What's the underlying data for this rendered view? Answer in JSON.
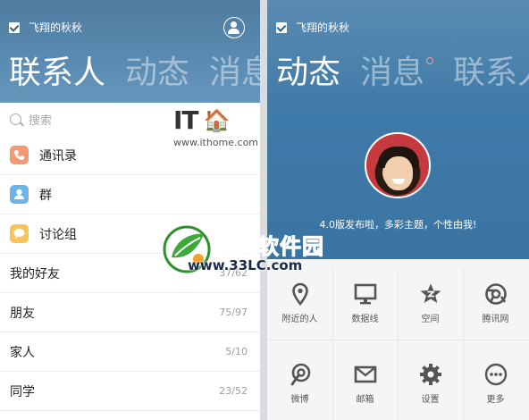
{
  "left": {
    "account_name": "飞翔的秋秋",
    "tabs": [
      {
        "label": "联系人"
      },
      {
        "label": "动态"
      },
      {
        "label": "消息"
      }
    ],
    "search_placeholder": "搜索",
    "entries": [
      {
        "label": "通讯录",
        "icon": "phone-icon",
        "color": "#f39a74"
      },
      {
        "label": "群",
        "icon": "group-icon",
        "color": "#6cb3e8"
      },
      {
        "label": "讨论组",
        "icon": "chat-icon",
        "color": "#f6c458"
      }
    ],
    "groups": [
      {
        "name": "我的好友",
        "count": "37/62"
      },
      {
        "name": "朋友",
        "count": "75/97"
      },
      {
        "name": "家人",
        "count": "5/10"
      },
      {
        "name": "同学",
        "count": "23/52"
      }
    ]
  },
  "right": {
    "account_name": "飞翔的秋秋",
    "tabs": [
      {
        "label": "动态"
      },
      {
        "label": "消息"
      },
      {
        "label": "联系人"
      }
    ],
    "slogan": "4.0版发布啦，多彩主题，个性由我!",
    "items": [
      {
        "label": "附近的人",
        "icon": "location-pin-icon"
      },
      {
        "label": "数据线",
        "icon": "monitor-icon"
      },
      {
        "label": "空间",
        "icon": "qzone-star-icon"
      },
      {
        "label": "腾讯网",
        "icon": "tencent-news-icon"
      },
      {
        "label": "微博",
        "icon": "weibo-icon"
      },
      {
        "label": "邮箱",
        "icon": "mail-icon"
      },
      {
        "label": "设置",
        "icon": "gear-icon"
      },
      {
        "label": "更多",
        "icon": "more-icon"
      }
    ]
  },
  "watermarks": {
    "ithome_logo": "IT之家",
    "ithome_url": "www.ithome.com",
    "green_logo": "绿茶软件园",
    "green_url": "www.33LC.com"
  }
}
